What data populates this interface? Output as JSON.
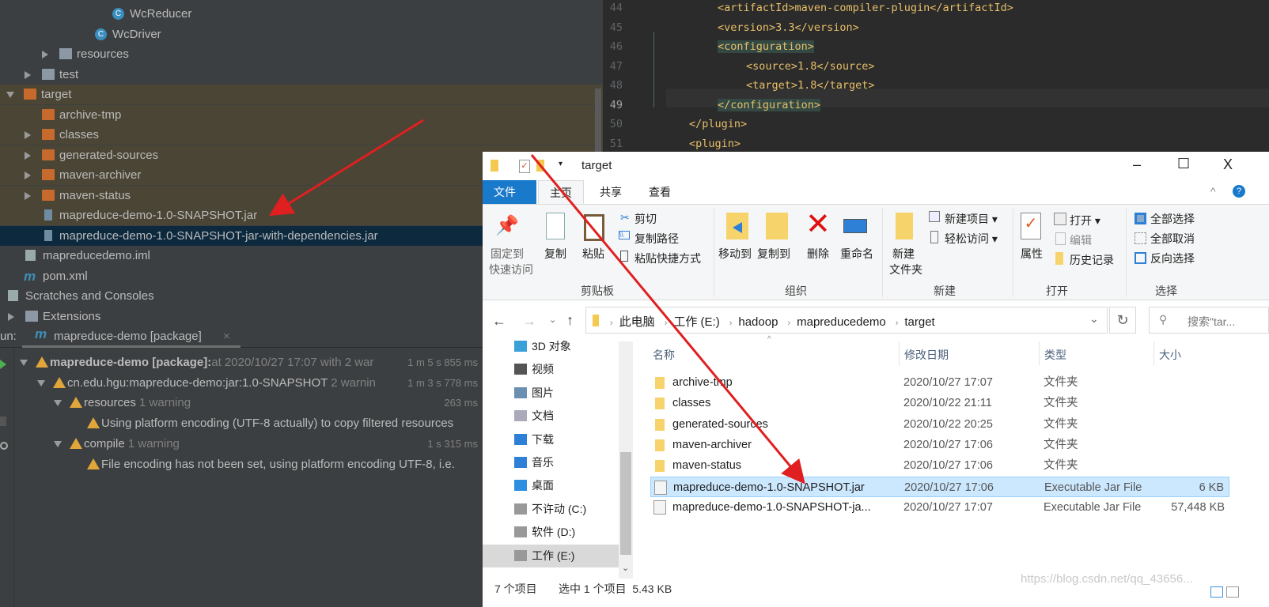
{
  "project_tree": {
    "items": [
      {
        "label": "WcReducer",
        "icon": "class-icon",
        "indent": 142,
        "arrow": ""
      },
      {
        "label": "WcDriver",
        "icon": "class-icon",
        "indent": 120,
        "arrow": ""
      },
      {
        "label": "resources",
        "icon": "folder-icon",
        "indent": 75,
        "arrow": "closed"
      },
      {
        "label": "test",
        "icon": "folder-icon",
        "indent": 53,
        "arrow": "closed"
      },
      {
        "label": "target",
        "icon": "folder-orange-icon",
        "indent": 30,
        "arrow": "open",
        "hl": true
      },
      {
        "label": "archive-tmp",
        "icon": "folder-orange-icon",
        "indent": 53,
        "arrow": "",
        "hl": true
      },
      {
        "label": "classes",
        "icon": "folder-orange-icon",
        "indent": 53,
        "arrow": "closed",
        "hl": true
      },
      {
        "label": "generated-sources",
        "icon": "folder-orange-icon",
        "indent": 53,
        "arrow": "closed",
        "hl": true
      },
      {
        "label": "maven-archiver",
        "icon": "folder-orange-icon",
        "indent": 53,
        "arrow": "closed",
        "hl": true
      },
      {
        "label": "maven-status",
        "icon": "folder-orange-icon",
        "indent": 53,
        "arrow": "closed",
        "hl": true
      },
      {
        "label": "mapreduce-demo-1.0-SNAPSHOT.jar",
        "icon": "jar-icon",
        "indent": 53,
        "arrow": "",
        "hl": true
      },
      {
        "label": "mapreduce-demo-1.0-SNAPSHOT-jar-with-dependencies.jar",
        "icon": "jar-icon",
        "indent": 53,
        "arrow": "",
        "sel": true
      },
      {
        "label": "mapreducedemo.iml",
        "icon": "iml-icon",
        "indent": 32,
        "arrow": ""
      },
      {
        "label": "pom.xml",
        "icon": "maven-icon",
        "indent": 32,
        "arrow": ""
      },
      {
        "label": "Scratches and Consoles",
        "icon": "scratches-icon",
        "indent": 10,
        "arrow": ""
      },
      {
        "label": "Extensions",
        "icon": "folder-icon",
        "indent": 32,
        "arrow": "closed"
      }
    ]
  },
  "editor": {
    "lines": [
      {
        "n": "44",
        "indent": 3,
        "code": "<artifactId>maven-compiler-plugin</artifactId>"
      },
      {
        "n": "45",
        "indent": 3,
        "code": "<version>3.3</version>"
      },
      {
        "n": "46",
        "indent": 3,
        "code": "<configuration>"
      },
      {
        "n": "47",
        "indent": 4,
        "code": "<source>1.8</source>"
      },
      {
        "n": "48",
        "indent": 4,
        "code": "<target>1.8</target>"
      },
      {
        "n": "49",
        "indent": 3,
        "code": "</configuration>"
      },
      {
        "n": "50",
        "indent": 2,
        "code": "</plugin>"
      },
      {
        "n": "51",
        "indent": 2,
        "code": "<plugin>"
      }
    ]
  },
  "run": {
    "label": "un:",
    "tab": "mapreduce-demo [package]",
    "rows": [
      {
        "indent": 45,
        "arrow": true,
        "bold": "mapreduce-demo [package]:",
        "text": "at 2020/10/27 17:07 with 2 war",
        "dim": "",
        "time": "1 m 5 s 855 ms"
      },
      {
        "indent": 67,
        "arrow": true,
        "bold": "",
        "text": "cn.edu.hgu:mapreduce-demo:jar:1.0-SNAPSHOT",
        "dim": "2 warnin",
        "time": "1 m 3 s 778 ms"
      },
      {
        "indent": 88,
        "arrow": true,
        "bold": "",
        "text": "resources",
        "dim": "1 warning",
        "time": "263 ms"
      },
      {
        "indent": 110,
        "arrow": false,
        "bold": "",
        "text": "Using platform encoding (UTF-8 actually) to copy filtered resources",
        "dim": "",
        "time": ""
      },
      {
        "indent": 88,
        "arrow": true,
        "bold": "",
        "text": "compile",
        "dim": "1 warning",
        "time": "1 s 315 ms"
      },
      {
        "indent": 110,
        "arrow": false,
        "bold": "",
        "text": "File encoding has not been set, using platform encoding UTF-8, i.e.",
        "dim": "",
        "time": ""
      }
    ]
  },
  "explorer": {
    "title": "target",
    "window_controls": {
      "minimize": "–",
      "maximize": "☐",
      "close": "X"
    },
    "tabs": [
      "文件",
      "主页",
      "共享",
      "查看"
    ],
    "ribbon": {
      "clipboard": {
        "pin": "固定到",
        "pin2": "快速访问",
        "copy": "复制",
        "paste": "粘贴",
        "cut": "剪切",
        "copy_path": "复制路径",
        "paste_shortcut": "粘贴快捷方式",
        "group": "剪贴板"
      },
      "organize": {
        "move_to": "移动到",
        "copy_to": "复制到",
        "delete": "删除",
        "rename": "重命名",
        "group": "组织"
      },
      "new": {
        "new_folder": "新建",
        "new_folder2": "文件夹",
        "new_item": "新建项目",
        "easy_access": "轻松访问",
        "group": "新建"
      },
      "open": {
        "properties": "属性",
        "open": "打开",
        "edit": "编辑",
        "history": "历史记录",
        "group": "打开"
      },
      "select": {
        "select_all": "全部选择",
        "select_none": "全部取消",
        "invert": "反向选择",
        "group": "选择"
      }
    },
    "address": [
      "此电脑",
      "工作 (E:)",
      "hadoop",
      "mapreducedemo",
      "target"
    ],
    "search_placeholder": "搜索\"tar...",
    "columns": {
      "name": "名称",
      "date": "修改日期",
      "type": "类型",
      "size": "大小"
    },
    "nav": [
      {
        "label": "3D 对象",
        "icon": "3d-objects-icon",
        "color": "#3aa0d8"
      },
      {
        "label": "视频",
        "icon": "video-icon",
        "color": "#555"
      },
      {
        "label": "图片",
        "icon": "pictures-icon",
        "color": "#6b8fb0"
      },
      {
        "label": "文档",
        "icon": "documents-icon",
        "color": "#aab"
      },
      {
        "label": "下载",
        "icon": "download-icon",
        "color": "#2e7fd6"
      },
      {
        "label": "音乐",
        "icon": "music-icon",
        "color": "#2e7fd6"
      },
      {
        "label": "桌面",
        "icon": "desktop-icon",
        "color": "#2e8fe0"
      },
      {
        "label": "不许动 (C:)",
        "icon": "drive-icon",
        "color": "#999"
      },
      {
        "label": "软件 (D:)",
        "icon": "drive-icon",
        "color": "#999"
      },
      {
        "label": "工作 (E:)",
        "icon": "drive-icon",
        "color": "#999",
        "sel": true
      }
    ],
    "files": [
      {
        "name": "archive-tmp",
        "date": "2020/10/27 17:07",
        "type": "文件夹",
        "size": "",
        "kind": "folder"
      },
      {
        "name": "classes",
        "date": "2020/10/22 21:11",
        "type": "文件夹",
        "size": "",
        "kind": "folder"
      },
      {
        "name": "generated-sources",
        "date": "2020/10/22 20:25",
        "type": "文件夹",
        "size": "",
        "kind": "folder"
      },
      {
        "name": "maven-archiver",
        "date": "2020/10/27 17:06",
        "type": "文件夹",
        "size": "",
        "kind": "folder"
      },
      {
        "name": "maven-status",
        "date": "2020/10/27 17:06",
        "type": "文件夹",
        "size": "",
        "kind": "folder"
      },
      {
        "name": "mapreduce-demo-1.0-SNAPSHOT.jar",
        "date": "2020/10/27 17:06",
        "type": "Executable Jar File",
        "size": "6 KB",
        "kind": "jar",
        "sel": true
      },
      {
        "name": "mapreduce-demo-1.0-SNAPSHOT-ja...",
        "date": "2020/10/27 17:07",
        "type": "Executable Jar File",
        "size": "57,448 KB",
        "kind": "jar"
      }
    ],
    "status": {
      "count": "7 个项目",
      "selected": "选中 1 个项目  5.43 KB"
    },
    "watermark": "https://blog.csdn.net/qq_43656..."
  },
  "colors": {
    "accent_blue": "#1979ca",
    "arrow_red": "#e02020",
    "selection": "#cce8ff"
  }
}
